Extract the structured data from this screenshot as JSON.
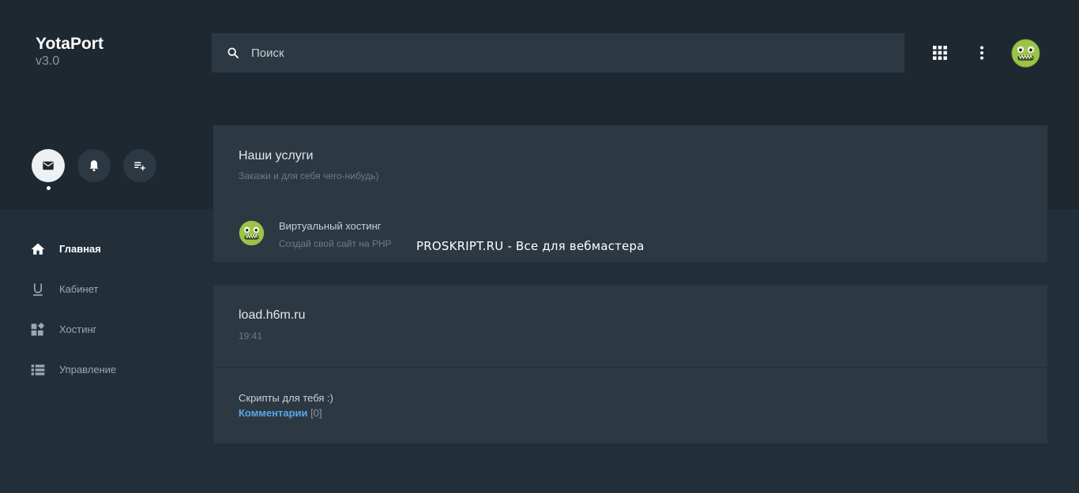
{
  "brand": {
    "name": "YotaPort",
    "version": "v3.0"
  },
  "search": {
    "placeholder": "Поиск",
    "value": ""
  },
  "header_icons": [
    "apps-grid-icon",
    "more-vert-icon",
    "user-avatar"
  ],
  "quick_actions": [
    {
      "name": "mail-icon",
      "active": true
    },
    {
      "name": "bell-icon",
      "active": false
    },
    {
      "name": "playlist-add-icon",
      "active": false
    }
  ],
  "nav": {
    "items": [
      {
        "label": "Главная",
        "icon": "home-icon",
        "active": true
      },
      {
        "label": "Кабинет",
        "icon": "underline-u-icon",
        "active": false
      },
      {
        "label": "Хостинг",
        "icon": "widgets-icon",
        "active": false
      },
      {
        "label": "Управление",
        "icon": "list-icon",
        "active": false
      }
    ]
  },
  "services_card": {
    "title": "Наши услуги",
    "subtitle": "Закажи и для себя чего-нибудь)",
    "item": {
      "name": "Виртуальный хостинг",
      "description": "Создай свой сайт на PHP"
    }
  },
  "watermark": "PROSKRIPT.RU - Все для вебмастера",
  "post_card": {
    "title": "load.h6m.ru",
    "time": "19:41",
    "text": "Скрипты для тебя :)",
    "comments_label": "Комментарии",
    "comments_count": "[0]"
  },
  "colors": {
    "background": "#232f38",
    "header_band": "#1e2831",
    "card": "#2c3943",
    "link": "#5aa6ea",
    "avatar": "#9bc34a"
  }
}
